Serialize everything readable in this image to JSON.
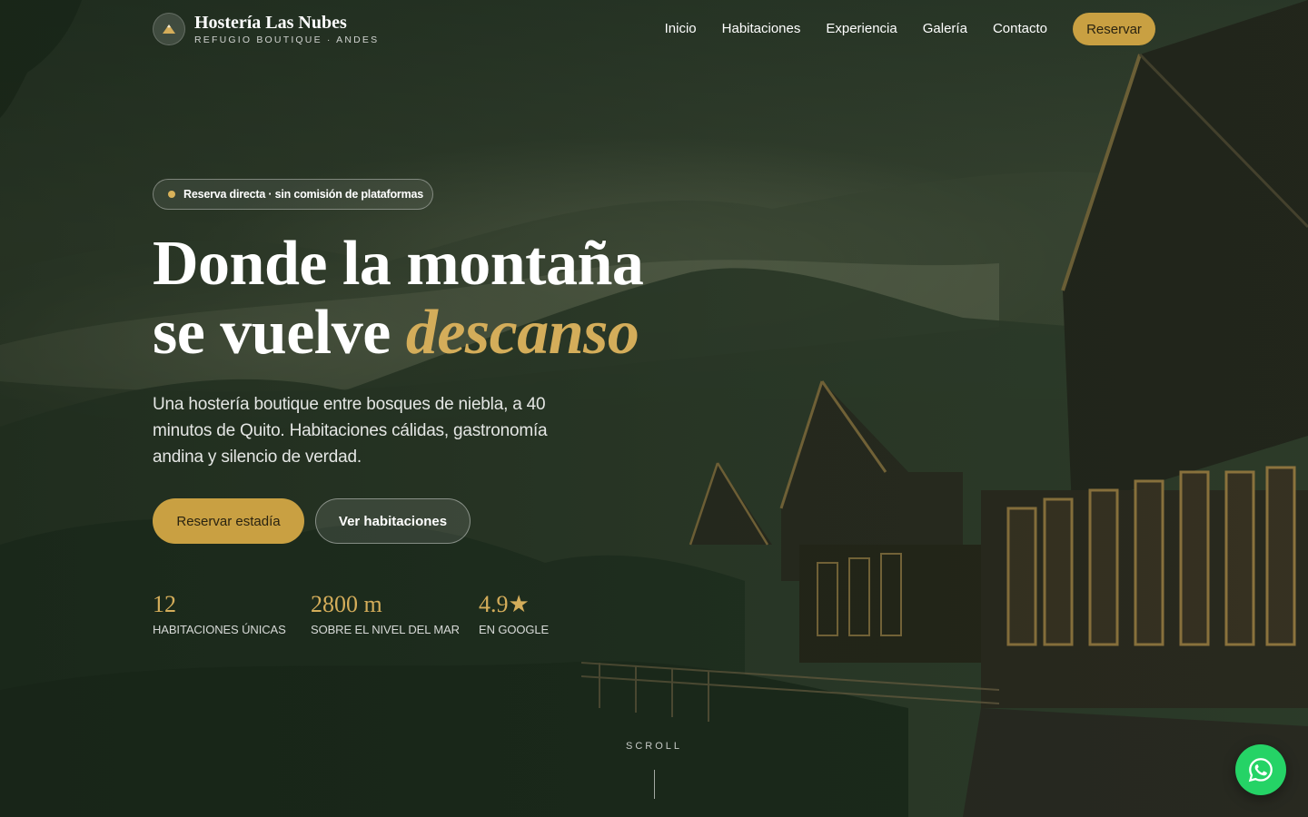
{
  "brand": {
    "name": "Hostería Las Nubes",
    "tagline": "REFUGIO BOUTIQUE · ANDES",
    "logo_icon": "mountain-icon"
  },
  "nav": {
    "links": [
      "Inicio",
      "Habitaciones",
      "Experiencia",
      "Galería",
      "Contacto"
    ],
    "cta": "Reservar"
  },
  "hero": {
    "badge": "Reserva directa · sin comisión de plataformas",
    "headline_line1": "Donde la montaña",
    "headline_line2": "se vuelve",
    "headline_accent": "descanso",
    "lead": "Una hostería boutique entre bosques de niebla, a 40 minutos de Quito. Habitaciones cálidas, gastronomía andina y silencio de verdad.",
    "primary_cta": "Reservar estadía",
    "secondary_cta": "Ver habitaciones",
    "stats": [
      {
        "value": "12",
        "label": "HABITACIONES ÚNICAS"
      },
      {
        "value": "2800 m",
        "label": "SOBRE EL NIVEL DEL MAR"
      },
      {
        "value": "4.9★",
        "label": "EN GOOGLE"
      }
    ],
    "scroll_label": "SCROLL"
  },
  "whatsapp": {
    "icon": "whatsapp-icon"
  },
  "colors": {
    "accent": "#c9a042",
    "accent_text": "#d4ad5a",
    "whatsapp": "#25d366"
  }
}
